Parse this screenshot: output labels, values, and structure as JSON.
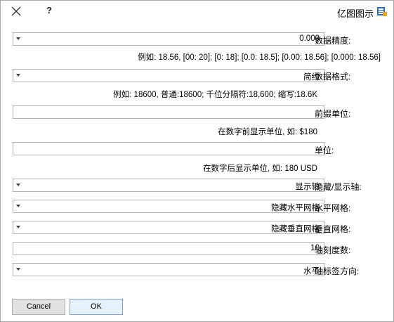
{
  "window": {
    "title": "亿图图示",
    "help_label": "?"
  },
  "icons": {
    "app": "edraw-app-icon",
    "close": "close-icon",
    "dropdown": "chevron-down-icon"
  },
  "fields": {
    "data_precision": {
      "label": "数据精度:",
      "value": "0.000",
      "hint": "例如: 18.56, [00: 20]; [0: 18]; [0.0: 18.5]; [0.00: 18.56]; [0.000: 18.56]"
    },
    "data_format": {
      "label": "数据格式:",
      "value": "简约",
      "hint": "例如: 18600, 普通:18600; 千位分隔符:18,600; 缩写:18.6K"
    },
    "prefix_unit": {
      "label": "前缀单位:",
      "value": "",
      "hint": "在数字前显示单位, 如: $180"
    },
    "unit": {
      "label": "单位:",
      "value": "",
      "hint": "在数字后显示单位, 如: 180 USD"
    },
    "hide_show_axis": {
      "label": "隐藏/显示轴:",
      "value": "显示轴"
    },
    "horizontal_grid": {
      "label": "水平网格:",
      "value": "隐藏水平网格"
    },
    "vertical_grid": {
      "label": "垂直网格:",
      "value": "隐藏垂直网格"
    },
    "axis_ticks": {
      "label": "轴刻度数:",
      "value": "10"
    },
    "axis_label_direction": {
      "label": "轴标签方向:",
      "value": "水平"
    }
  },
  "buttons": {
    "ok": "OK",
    "cancel": "Cancel"
  }
}
